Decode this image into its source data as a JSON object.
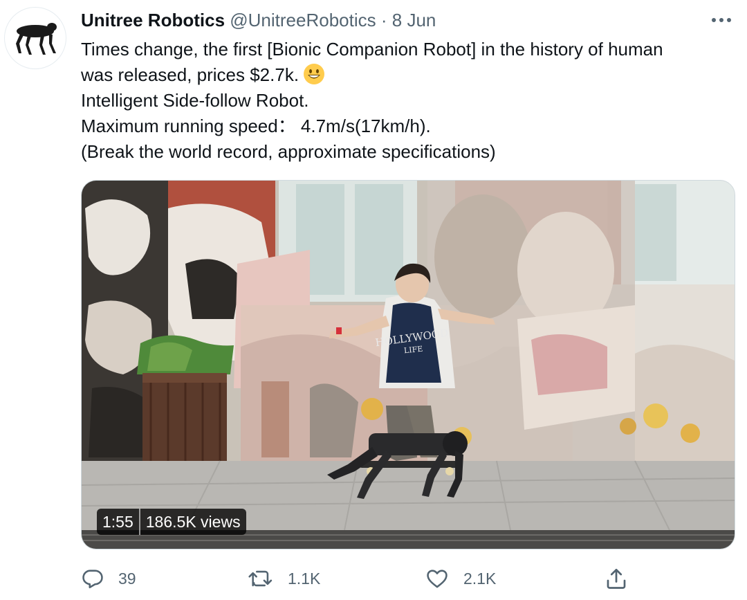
{
  "tweet": {
    "author_name": "Unitree Robotics",
    "handle": "@UnitreeRobotics",
    "separator": "·",
    "date": "8 Jun",
    "text_lines": [
      "Times change, the first [Bionic Companion Robot] in the history of human",
      "was released, prices $2.7k.",
      "Intelligent Side-follow Robot.",
      "Maximum running speed： 4.7m/s(17km/h).",
      "(Break the world record, approximate specifications)"
    ],
    "emoji": "grinning-face-emoji"
  },
  "video": {
    "duration": "1:55",
    "views": "186.5K views"
  },
  "actions": {
    "reply_count": "39",
    "retweet_count": "1.1K",
    "like_count": "2.1K"
  },
  "icons": [
    "more-icon",
    "reply-icon",
    "retweet-icon",
    "like-icon",
    "share-icon"
  ]
}
